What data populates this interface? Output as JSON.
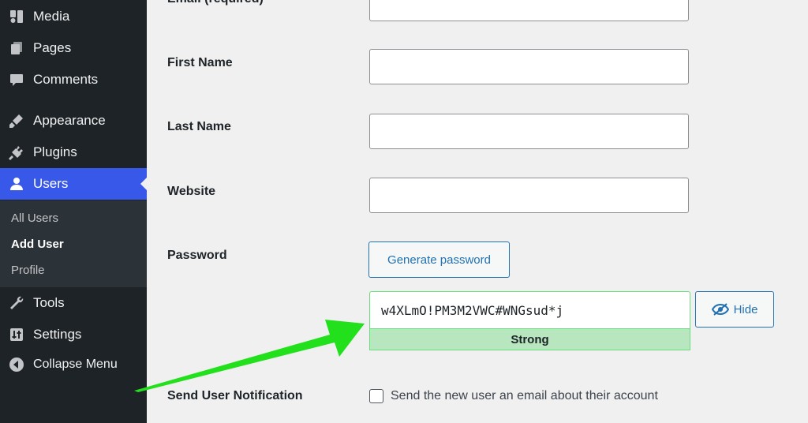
{
  "sidebar": {
    "items": [
      {
        "label": "Media",
        "icon": "media-icon"
      },
      {
        "label": "Pages",
        "icon": "pages-icon"
      },
      {
        "label": "Comments",
        "icon": "comments-icon"
      },
      {
        "label": "Appearance",
        "icon": "appearance-icon"
      },
      {
        "label": "Plugins",
        "icon": "plugins-icon"
      },
      {
        "label": "Users",
        "icon": "users-icon",
        "active": true
      },
      {
        "label": "Tools",
        "icon": "tools-icon"
      },
      {
        "label": "Settings",
        "icon": "settings-icon"
      },
      {
        "label": "Collapse Menu",
        "icon": "collapse-icon"
      }
    ],
    "submenu": [
      {
        "label": "All Users"
      },
      {
        "label": "Add User",
        "current": true
      },
      {
        "label": "Profile"
      }
    ]
  },
  "form": {
    "email_label": "Email (required)",
    "first_name_label": "First Name",
    "last_name_label": "Last Name",
    "website_label": "Website",
    "password_label": "Password",
    "generate_password_label": "Generate password",
    "password_value": "w4XLmO!PM3M2VWC#WNGsud*j",
    "password_strength": "Strong",
    "hide_label": "Hide",
    "notification_label": "Send User Notification",
    "notification_checkbox_label": "Send the new user an email about their account"
  },
  "colors": {
    "sidebar_bg": "#1d2327",
    "active_bg": "#3858e9",
    "button_blue": "#2271b1",
    "strength_bg": "#b8e6bf",
    "arrow_green": "#22e01c"
  }
}
